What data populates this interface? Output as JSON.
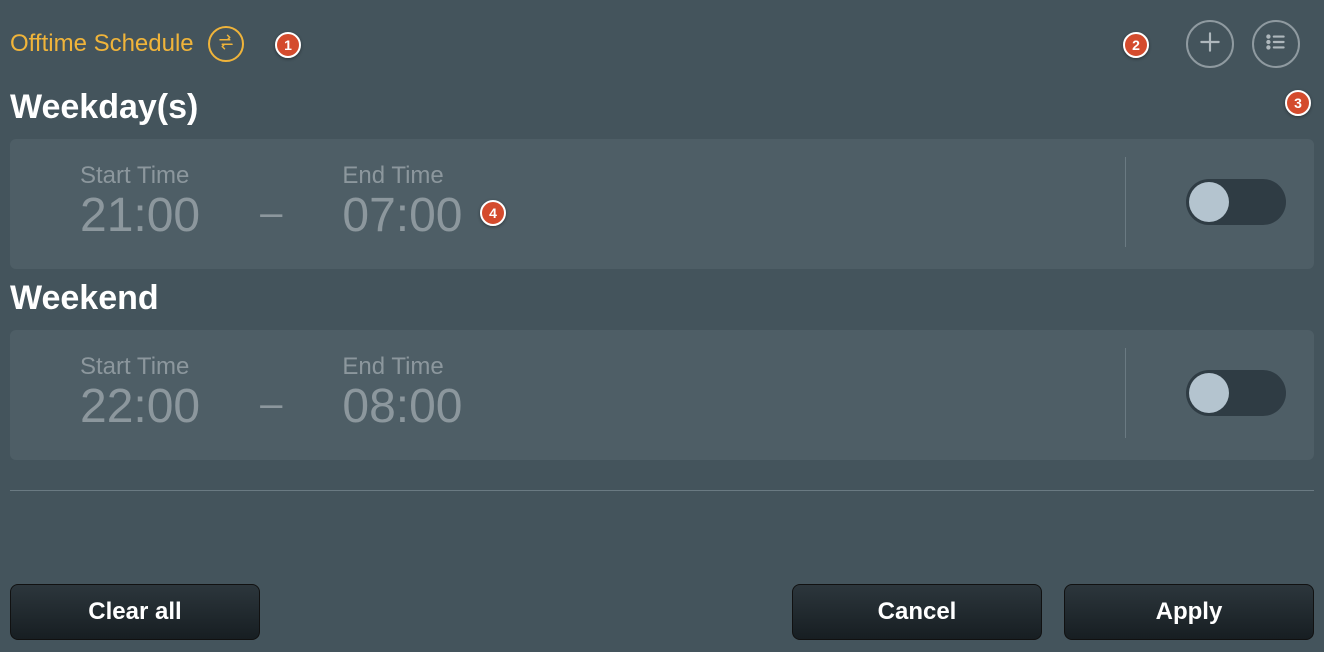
{
  "header": {
    "title": "Offtime Schedule",
    "swap_icon": "swap-horizontal-icon",
    "add_icon": "plus-icon",
    "list_icon": "list-icon"
  },
  "sections": [
    {
      "heading": "Weekday(s)",
      "start_label": "Start Time",
      "start_value": "21:00",
      "end_label": "End Time",
      "end_value": "07:00",
      "enabled": false
    },
    {
      "heading": "Weekend",
      "start_label": "Start Time",
      "start_value": "22:00",
      "end_label": "End Time",
      "end_value": "08:00",
      "enabled": false
    }
  ],
  "footer": {
    "clear_label": "Clear all",
    "cancel_label": "Cancel",
    "apply_label": "Apply"
  },
  "annotations": {
    "b1": "1",
    "b2": "2",
    "b3": "3",
    "b4": "4"
  }
}
